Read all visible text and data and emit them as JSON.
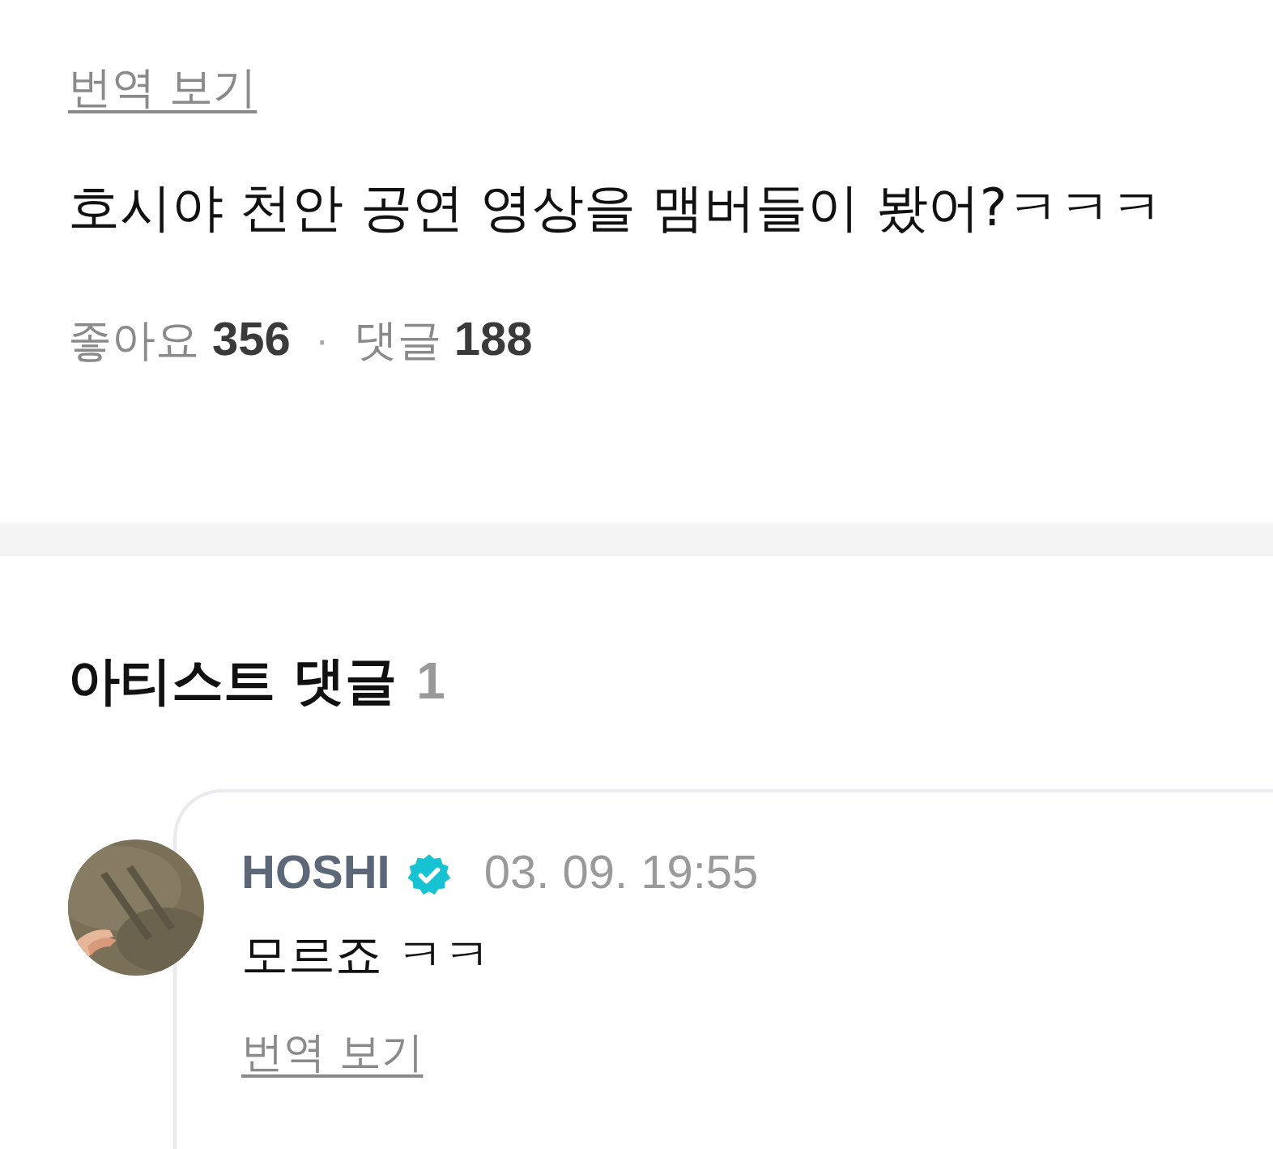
{
  "top_translate_link": "번역 보기",
  "post": {
    "text": "호시야 천안 공연 영상을 맴버들이 봤어?ㅋㅋㅋ",
    "likes_label": "좋아요",
    "likes": "356",
    "separator": "·",
    "comments_label": "댓글",
    "comments": "188"
  },
  "artist_comments": {
    "title": "아티스트 댓글",
    "count": "1",
    "items": [
      {
        "author": "HOSHI",
        "verified": true,
        "time": "03. 09. 19:55",
        "text": "모르죠 ㅋㅋ",
        "translate_link": "번역 보기"
      }
    ]
  }
}
